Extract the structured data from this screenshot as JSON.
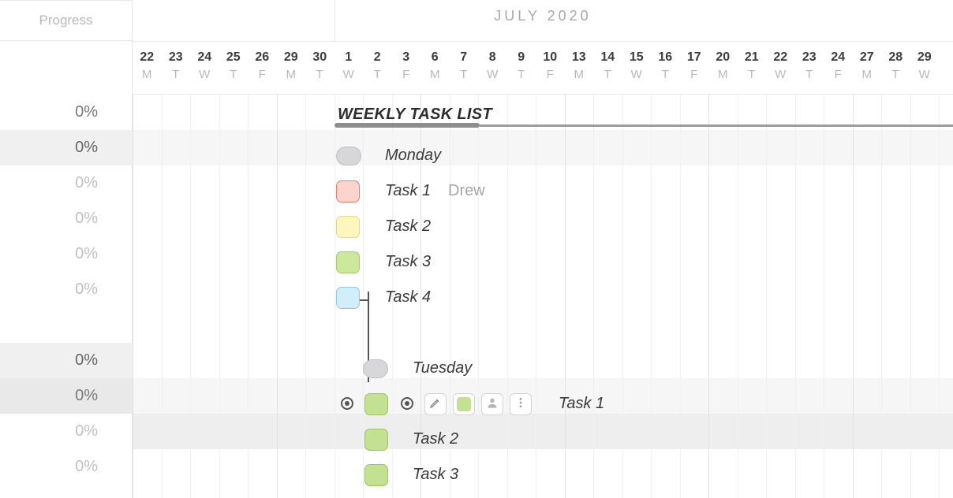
{
  "progress_header": "Progress",
  "month_label": "JULY 2020",
  "dates": [
    {
      "n": "22",
      "d": "M"
    },
    {
      "n": "23",
      "d": "T"
    },
    {
      "n": "24",
      "d": "W"
    },
    {
      "n": "25",
      "d": "T"
    },
    {
      "n": "26",
      "d": "F"
    },
    {
      "n": "29",
      "d": "M"
    },
    {
      "n": "30",
      "d": "T"
    },
    {
      "n": "1",
      "d": "W"
    },
    {
      "n": "2",
      "d": "T"
    },
    {
      "n": "3",
      "d": "F"
    },
    {
      "n": "6",
      "d": "M"
    },
    {
      "n": "7",
      "d": "T"
    },
    {
      "n": "8",
      "d": "W"
    },
    {
      "n": "9",
      "d": "T"
    },
    {
      "n": "10",
      "d": "F"
    },
    {
      "n": "13",
      "d": "M"
    },
    {
      "n": "14",
      "d": "T"
    },
    {
      "n": "15",
      "d": "W"
    },
    {
      "n": "16",
      "d": "T"
    },
    {
      "n": "17",
      "d": "F"
    },
    {
      "n": "20",
      "d": "M"
    },
    {
      "n": "21",
      "d": "T"
    },
    {
      "n": "22",
      "d": "W"
    },
    {
      "n": "23",
      "d": "T"
    },
    {
      "n": "24",
      "d": "F"
    },
    {
      "n": "27",
      "d": "M"
    },
    {
      "n": "28",
      "d": "T"
    },
    {
      "n": "29",
      "d": "W"
    }
  ],
  "progress": [
    "0%",
    "0%",
    "0%",
    "0%",
    "0%",
    "0%",
    "",
    "",
    "0%",
    "0%",
    "0%",
    "0%"
  ],
  "group_title": "WEEKLY TASK LIST",
  "rows": {
    "monday": "Monday",
    "task1": "Task 1",
    "assignee1": "Drew",
    "task2": "Task 2",
    "task3": "Task 3",
    "task4": "Task 4",
    "tuesday": "Tuesday",
    "t_task1": "Task 1",
    "t_task2": "Task 2",
    "t_task3": "Task 3"
  }
}
